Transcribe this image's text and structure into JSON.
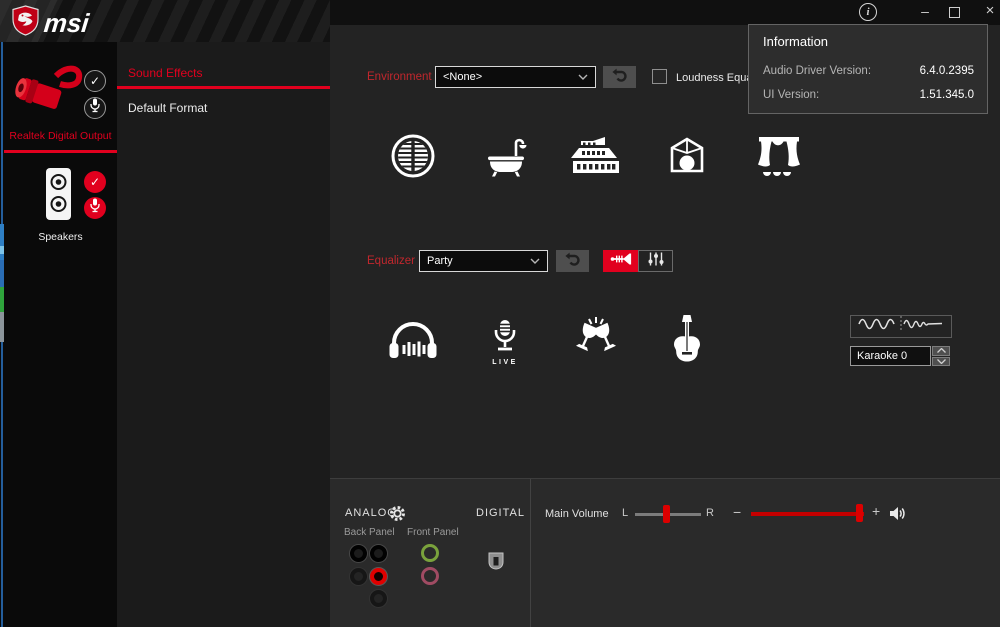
{
  "colors": {
    "accent_red": "#e1001e",
    "label_red": "#c1272d",
    "sidebar_bg": "#0a0a0a",
    "tab_panel_bg": "#1b1b1b",
    "main_bg": "#232323",
    "bottom_bg": "#2a2a2a",
    "popup_bg": "#2d2d2d",
    "jack_active_red": "#e00000",
    "jack_green": "#7aa23c",
    "jack_pink": "#a04b63"
  },
  "brand": {
    "name": "msi",
    "logo_icon": "msi-dragon-shield-icon"
  },
  "titlebar": {
    "info_glyph": "i",
    "minimize_glyph": "–",
    "close_glyph": "×",
    "maximize_icon": "square-outline-icon"
  },
  "info_popup": {
    "title": "Information",
    "rows": [
      {
        "label": "Audio Driver Version:",
        "value": "6.4.0.2395"
      },
      {
        "label": "UI Version:",
        "value": "1.51.345.0"
      }
    ]
  },
  "devices": [
    {
      "label": "Realtek Digital Output",
      "selected": true,
      "icon": "spdif-connector-icon",
      "badges": [
        "check-icon",
        "mic-icon"
      ]
    },
    {
      "label": "Speakers",
      "selected": false,
      "icon": "speaker-cabinet-icon",
      "badges": [
        "check-icon",
        "mic-icon"
      ]
    }
  ],
  "tabs": [
    {
      "label": "Sound Effects",
      "active": true
    },
    {
      "label": "Default Format",
      "active": false
    }
  ],
  "environment": {
    "label": "Environment",
    "selected": "<None>",
    "reset_icon": "undo-arrow-icon",
    "preset_icons": [
      "padded-cell-icon",
      "bathroom-icon",
      "arena-icon",
      "stone-room-icon",
      "auditorium-icon"
    ]
  },
  "loudness": {
    "label": "Loudness Equalization",
    "checked": false
  },
  "equalizer": {
    "label": "Equalizer",
    "selected": "Party",
    "reset_icon": "undo-arrow-icon",
    "mode_icons": [
      "trumpet-icon",
      "sliders-icon"
    ],
    "active_mode": 0,
    "preset_icons": [
      "headphones-icon",
      "live-mic-icon",
      "party-glasses-icon",
      "guitar-icon"
    ],
    "live_text": "LIVE",
    "voice_cancel_icon": "waveform-decay-icon",
    "karaoke": {
      "value": "Karaoke 0"
    }
  },
  "io": {
    "analog_label": "ANALOG",
    "settings_icon": "gear-icon",
    "digital_label": "DIGITAL",
    "back_panel_label": "Back Panel",
    "front_panel_label": "Front Panel",
    "digital_port_icon": "spdif-port-icon",
    "back_jacks": [
      "black",
      "black",
      "dim",
      "red-active",
      "dim"
    ],
    "front_jacks": [
      "green",
      "pink"
    ]
  },
  "volume": {
    "label": "Main Volume",
    "left_glyph": "L",
    "right_glyph": "R",
    "minus_glyph": "−",
    "plus_glyph": "+",
    "balance_pct": 50,
    "level_pct": 93,
    "speaker_icon": "speaker-volume-icon"
  }
}
